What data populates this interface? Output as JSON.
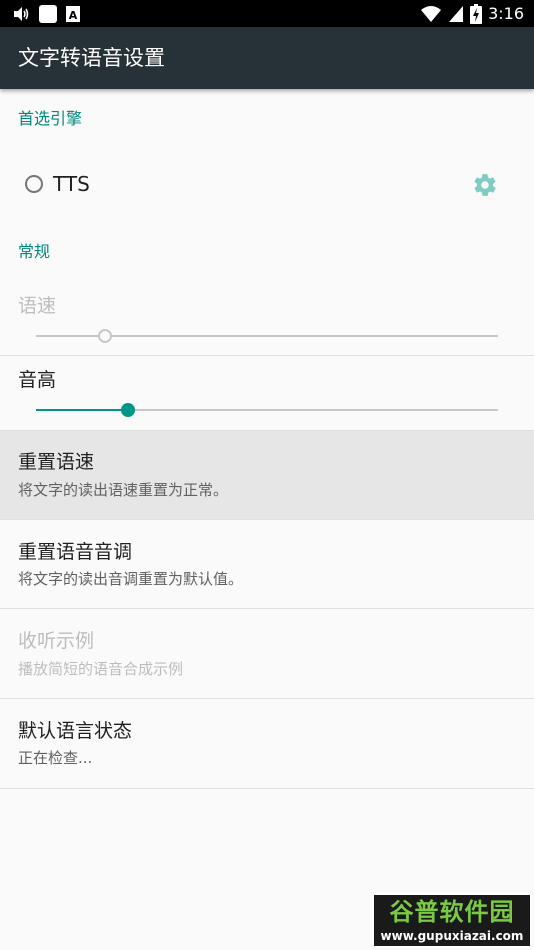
{
  "status_bar": {
    "time": "3:16",
    "icons": [
      "volume-icon",
      "square-notification-icon",
      "a-notification-icon",
      "wifi-icon",
      "signal-icon",
      "battery-charging-icon"
    ]
  },
  "app_bar": {
    "title": "文字转语音设置"
  },
  "preferred_engine": {
    "category": "首选引擎",
    "engine": {
      "label": "TTS",
      "selected": false
    }
  },
  "general": {
    "category": "常规",
    "speech_rate": {
      "label": "语速",
      "enabled": false,
      "value_fraction": 0.15
    },
    "pitch": {
      "label": "音高",
      "enabled": true,
      "value_fraction": 0.2
    },
    "reset_rate": {
      "title": "重置语速",
      "summary": "将文字的读出语速重置为正常。"
    },
    "reset_pitch": {
      "title": "重置语音音调",
      "summary": "将文字的读出音调重置为默认值。"
    },
    "listen_example": {
      "title": "收听示例",
      "summary": "播放简短的语音合成示例",
      "enabled": false
    },
    "language_status": {
      "title": "默认语言状态",
      "summary": "正在检查..."
    }
  },
  "colors": {
    "accent": "#009688",
    "appbar": "#263238",
    "category": "#00897b"
  },
  "watermark": {
    "brand": "谷普软件园",
    "url": "www.gupuxiazai.com"
  }
}
